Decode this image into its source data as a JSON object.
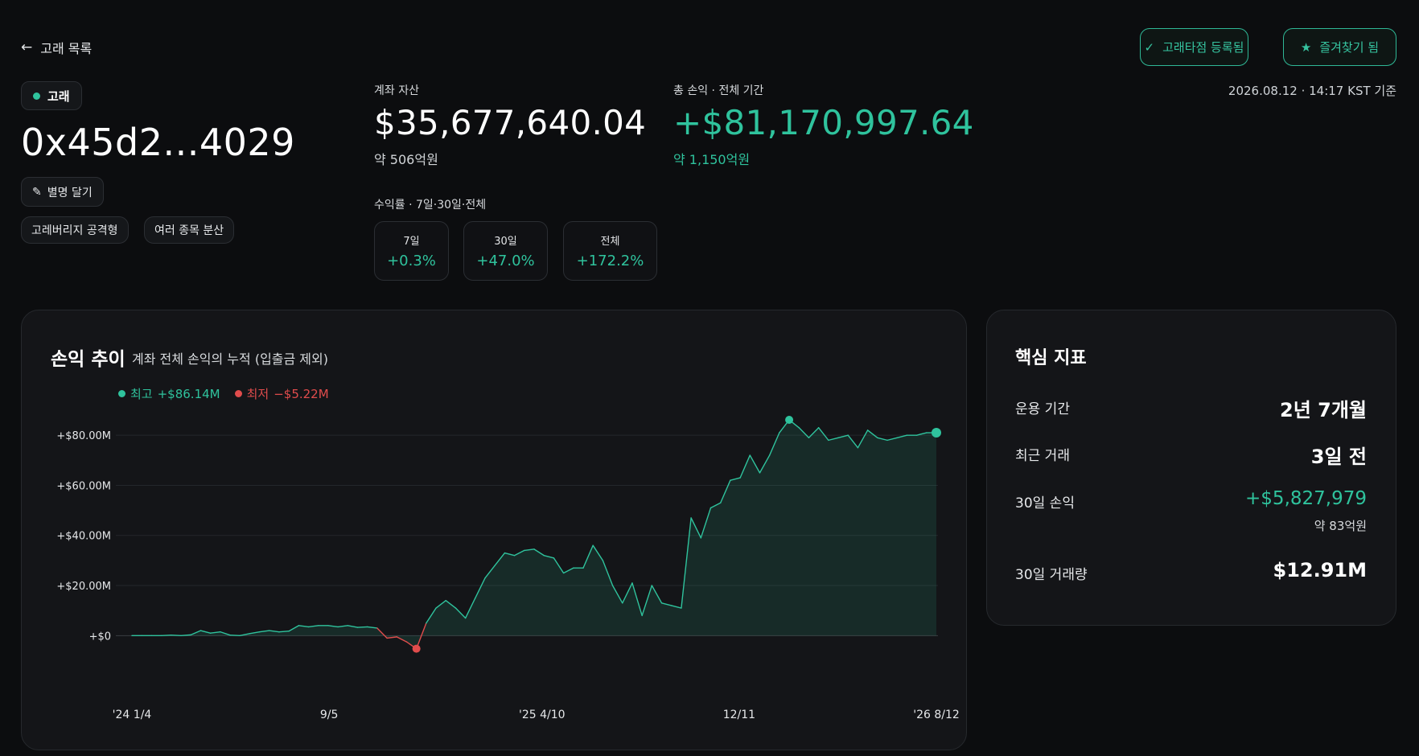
{
  "nav": {
    "back_label": "고래 목록",
    "dp_button": "고래타점 등록됨",
    "fav_button": "즐겨찾기 됨",
    "timestamp": "2026.08.12 · 14:17 KST 기준"
  },
  "profile": {
    "badge": "고래",
    "address": "0x45d2...4029",
    "nickname_button": "별명 달기",
    "tags": [
      "고레버리지 공격형",
      "여러 종목 분산"
    ]
  },
  "account": {
    "asset_label": "계좌 자산",
    "asset_value": "$35,677,640.04",
    "asset_sub": "약 506억원",
    "pnl_label": "총 손익 · 전체 기간",
    "pnl_value": "+$81,170,997.64",
    "pnl_sub": "약 1,150억원"
  },
  "returns": {
    "label": "수익률 · 7일·30일·전체",
    "items": [
      {
        "period": "7일",
        "value": "+0.3%"
      },
      {
        "period": "30일",
        "value": "+47.0%"
      },
      {
        "period": "전체",
        "value": "+172.2%"
      }
    ]
  },
  "chart_header": {
    "title": "손익 추이",
    "subtitle": "계좌 전체 손익의 누적 (입출금 제외)",
    "legend_high_label": "최고",
    "legend_high_value": "+$86.14M",
    "legend_low_label": "최저",
    "legend_low_value": "−$5.22M"
  },
  "chart_data": {
    "type": "area",
    "ytick_labels": [
      "+$0",
      "+$20.00M",
      "+$40.00M",
      "+$60.00M",
      "+$80.00M"
    ],
    "yticks": [
      0,
      20,
      40,
      60,
      80
    ],
    "ylim": [
      -6,
      90
    ],
    "xtick_labels": [
      "'24 1/4",
      "9/5",
      "'25 4/10",
      "12/11",
      "'26 8/12"
    ],
    "xtick_positions": [
      0,
      25,
      52,
      77,
      102
    ],
    "xlim": [
      0,
      102
    ],
    "series": [
      {
        "values": [
          0,
          0,
          0,
          0,
          0.2,
          0,
          0.3,
          2,
          1,
          1.5,
          0.2,
          0,
          0.8,
          1.5,
          2,
          1.5,
          1.8,
          4,
          3.5,
          4,
          4,
          3.5,
          4,
          3.3,
          3.5,
          3,
          -1,
          -0.5,
          -2.5,
          -5.22,
          5,
          11,
          14,
          11,
          7,
          15,
          23,
          28,
          33,
          32,
          34,
          34.5,
          32,
          31,
          25,
          27,
          27,
          36,
          30,
          20,
          13,
          21,
          8,
          20,
          13,
          12,
          11,
          47,
          39,
          51,
          53,
          62,
          63,
          72,
          65,
          72,
          81,
          86.14,
          83,
          79,
          83,
          78,
          79,
          80,
          75,
          82,
          79,
          78,
          79,
          80,
          80,
          81,
          81
        ]
      }
    ],
    "color": "#2fc39d",
    "negative_color": "#e04c4c",
    "max_point": {
      "index": 67,
      "value": 86.14
    },
    "min_point": {
      "index": 29,
      "value": -5.22
    },
    "grid": true
  },
  "metrics": {
    "title": "핵심 지표",
    "items": [
      {
        "label": "운용 기간",
        "value": "2년 7개월"
      },
      {
        "label": "최근 거래",
        "value": "3일 전"
      },
      {
        "label": "30일 손익",
        "value": "+$5,827,979",
        "sub": "약 83억원"
      },
      {
        "label": "30일 거래량",
        "value": "$12.91M"
      }
    ]
  },
  "colors": {
    "accent": "#2fc39d",
    "negative": "#e04c4c",
    "background": "#0c0d0f",
    "card": "#141518"
  }
}
